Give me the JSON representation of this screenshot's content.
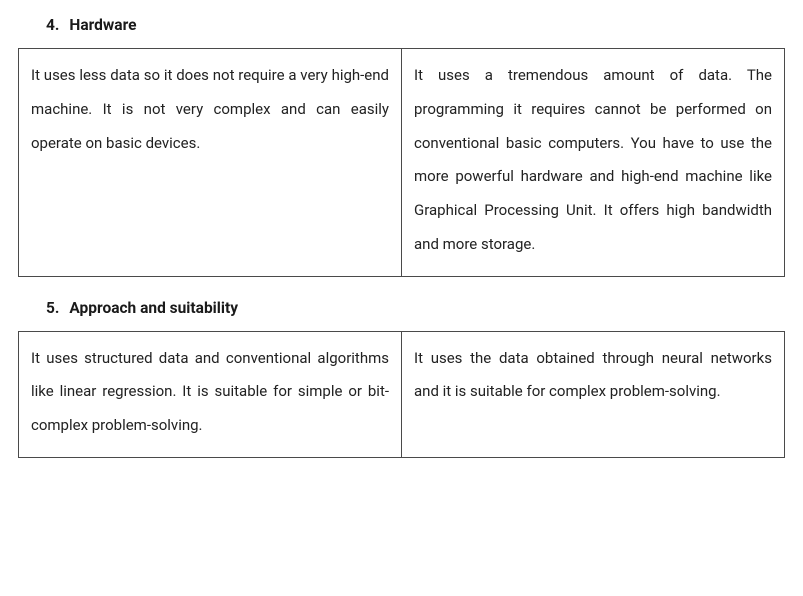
{
  "sections": [
    {
      "number": "4.",
      "title": "Hardware",
      "left": "It uses less data so it does not require a very high-end machine. It is not very complex and can easily operate on basic devices.",
      "right": "It uses a tremendous amount of data. The programming it requires cannot be performed on conventional basic computers. You have to use the more powerful hardware and high-end machine like Graphical Processing Unit. It offers high bandwidth and more storage."
    },
    {
      "number": "5.",
      "title": "Approach and suitability",
      "left": "It uses structured data and conventional algorithms like linear regression. It is suitable for simple or bit-complex problem-solving.",
      "right": "It uses the data obtained through neural networks and it is suitable for complex problem-solving."
    }
  ]
}
